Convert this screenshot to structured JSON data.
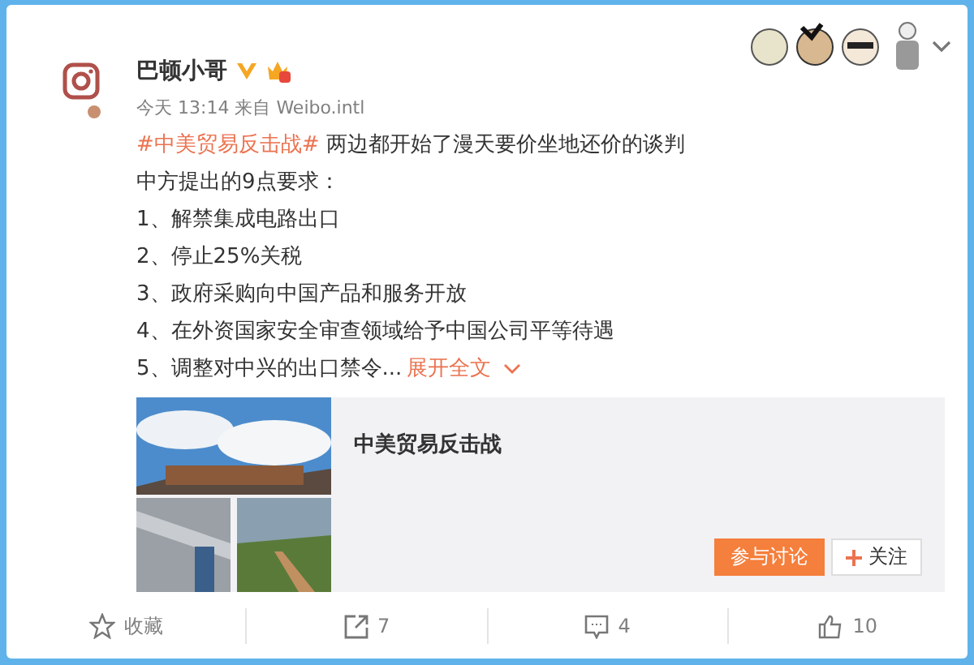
{
  "post": {
    "author": "巴顿小哥",
    "time": "今天 13:14",
    "source": "来自 Weibo.intl",
    "hashtag": "#中美贸易反击战#",
    "headline": "两边都开始了漫天要价坐地还价的谈判",
    "lines": [
      "中方提出的9点要求：",
      "1、解禁集成电路出口",
      "2、停止25%关税",
      "3、政府采购向中国产品和服务开放",
      "4、在外资国家安全审查领域给予中国公司平等待遇"
    ],
    "last_line": "5、调整对中兴的出口禁令...",
    "expand": "展开全文"
  },
  "topic_card": {
    "title": "中美贸易反击战",
    "discuss_button": "参与讨论",
    "follow_button": "关注"
  },
  "actions": [
    {
      "kind": "favorite",
      "label": "收藏"
    },
    {
      "kind": "share",
      "label": "7"
    },
    {
      "kind": "comment",
      "label": "4"
    },
    {
      "kind": "like",
      "label": "10"
    }
  ]
}
